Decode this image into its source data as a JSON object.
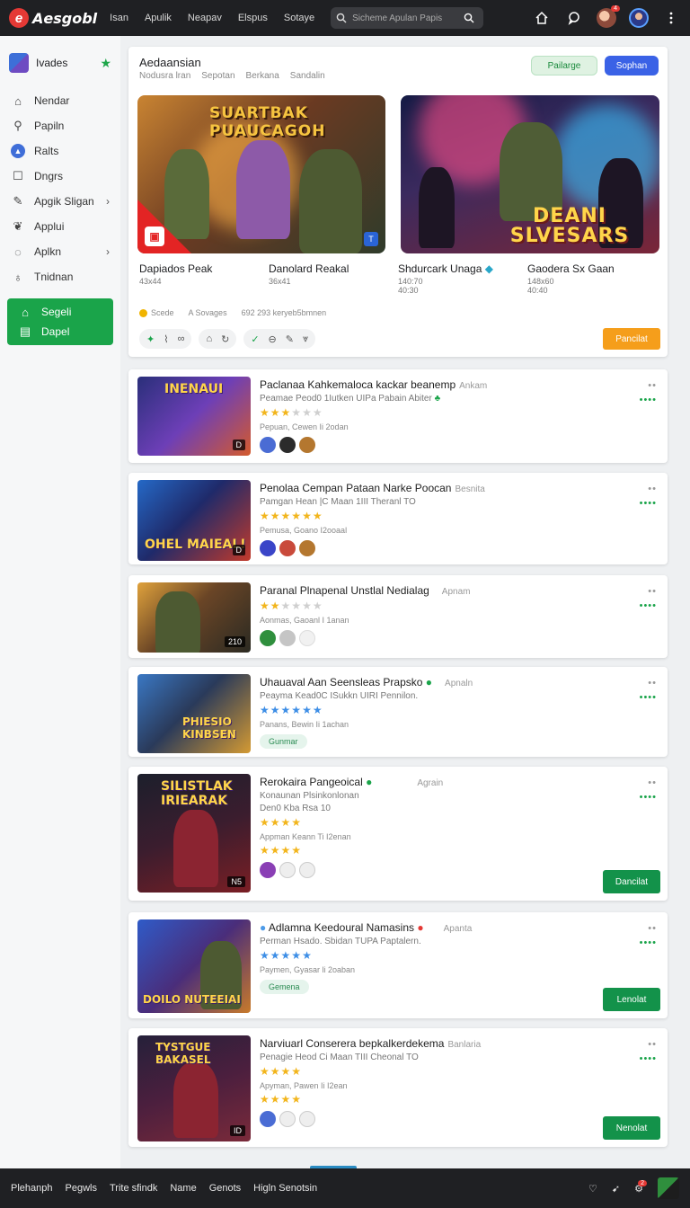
{
  "app": {
    "name": "Aesgobl",
    "nav": [
      "Isan",
      "Apulik",
      "Neapav",
      "Elspus",
      "Sotaye"
    ],
    "search_placeholder": "Sicheme Apulan Papis",
    "notif_count": "4"
  },
  "sidebar": {
    "header": "Ivades",
    "items": [
      {
        "label": "Nendar",
        "icon": "home-icon"
      },
      {
        "label": "Papiln",
        "icon": "search-icon"
      },
      {
        "label": "Ralts",
        "icon": "radar-icon"
      },
      {
        "label": "Dngrs",
        "icon": "edit-icon"
      },
      {
        "label": "Apgik Sligan",
        "icon": "pencil-icon",
        "chevron": true
      },
      {
        "label": "Applui",
        "icon": "leaf-icon"
      },
      {
        "label": "Aplkn",
        "icon": "chat-icon",
        "chevron": true
      },
      {
        "label": "Tnidnan",
        "icon": "bag-icon"
      }
    ],
    "active_items": [
      "Segeli",
      "Dapel"
    ]
  },
  "featured": {
    "title": "Aedaansian",
    "subtitle": [
      "Nodusra lran",
      "Sepotan",
      "Berkana",
      "Sandalin"
    ],
    "btn_green": "Pailarge",
    "btn_blue": "Sophan",
    "banner1_title": "SUARTBAK PUAUCAGOH",
    "banner2_title": "DEANI SLVESARS",
    "banner2_corner": "T",
    "games": [
      {
        "name": "Dapiados Peak",
        "count": "43x44"
      },
      {
        "name": "Danolard Reakal",
        "count": "36x41"
      },
      {
        "name": "Shdurcark Unaga",
        "count": "140:70\n40:30"
      },
      {
        "name": "Gaodera Sx Gaan",
        "count": "148x60\n40:40"
      }
    ],
    "meta": [
      "Scede",
      "A Sovages",
      "692",
      "293 keryeb5bmnen"
    ],
    "action_btn": "Pancilat"
  },
  "list": [
    {
      "title": "Paclanaa Kahkemaloca kackar beanemp",
      "tag": "Ankam",
      "sub": "Peamae Peod0 1Iutken UIPa Pabain Abiter",
      "stars_on": 3,
      "stars_total": 6,
      "star_color": "gold",
      "meta": "Pepuan, Cewen Ii 2odan",
      "thumb_title": "INENAUI",
      "thumb_badge": "D"
    },
    {
      "title": "Penolaa Cempan Pataan Narke Poocan",
      "tag": "Besnita",
      "sub": "Pamgan Hean |C Maan 1III Theranl TO",
      "stars_on": 6,
      "stars_total": 6,
      "star_color": "gold",
      "meta": "Pemusa, Goano I2ooaal",
      "thumb_title": "OHEL MAIEAL!",
      "thumb_badge": "D"
    },
    {
      "title": "Paranal Plnapenal Unstlal Nedialag",
      "tag": "Apnam",
      "sub": "",
      "stars_on": 2,
      "stars_total": 6,
      "star_color": "gold",
      "meta": "Aonmas, Gaoanl I 1anan",
      "thumb_title": "",
      "thumb_badge": "210"
    },
    {
      "title": "Uhauaval Aan Seensleas Prapsko",
      "tag": "Apnaln",
      "sub": "Peayma Kead0C ISukkn UIRI Pennilon.",
      "stars_on": 6,
      "stars_total": 6,
      "star_color": "blue",
      "meta": "Panans, Bewin Ii 1achan",
      "pill": "Gunmar",
      "thumb_title": "PHIESIO KINBSEN",
      "thumb_badge": ""
    },
    {
      "title": "Rerokaira Pangeoical",
      "tag": "Agrain",
      "sub": "Konaunan Plsinkonlonan",
      "sub2": "Den0 Kba Rsa 10",
      "stars_on": 4,
      "stars_total": 4,
      "star_color": "gold",
      "meta": "Appman Keann Ti I2enan",
      "thumb_title": "SILISTLAK IRIEARAK",
      "thumb_badge": "N5",
      "button": "Dancilat"
    },
    {
      "title": "Adlamna Keedoural Namasins",
      "tag": "Apanta",
      "sub": "Perman Hsado. Sbidan TUPA Paptalern.",
      "stars_on": 5,
      "stars_total": 5,
      "star_color": "blue",
      "meta": "Paymen, Gyasar li 2oaban",
      "pill": "Gemena",
      "thumb_title": "DOILO NUTEEIAI",
      "thumb_badge": "",
      "button": "Lenolat"
    },
    {
      "title": "Narviuarl Conserera bepkalkerdekema",
      "tag": "Banlaria",
      "sub": "Penagie Heod Ci Maan TIII Cheonal TO",
      "stars_on": 4,
      "stars_total": 4,
      "star_color": "gold",
      "meta": "Apyman, Pawen Ii I2ean",
      "thumb_title": "TYSTGUE BAKASEL",
      "thumb_badge": "ID",
      "button": "Nenolat"
    }
  ],
  "bottombar": {
    "links": [
      "Plehanph",
      "Pegwls",
      "Trite sfindk",
      "Name",
      "Genots",
      "Higln Senotsin"
    ],
    "notif": "2"
  }
}
